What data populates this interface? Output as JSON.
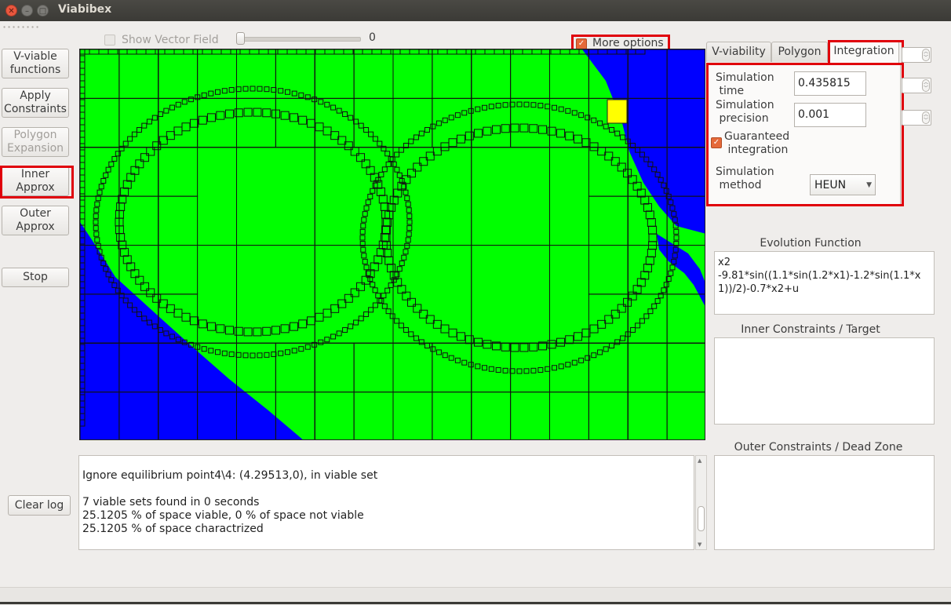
{
  "window": {
    "title": "Viabibex"
  },
  "left_buttons": {
    "vviable": "V-viable\nfunctions",
    "apply": "Apply\nConstraints",
    "polygon": "Polygon\nExpansion",
    "inner": "Inner\nApprox",
    "outer": "Outer\nApprox",
    "stop": "Stop",
    "clear_log": "Clear log"
  },
  "top_controls": {
    "show_vector_field": "Show Vector Field",
    "slider_value": "0",
    "more_options": "More options"
  },
  "tabs": [
    "V-viability",
    "Polygon",
    "Integration"
  ],
  "integration": {
    "sim_time_label": "Simulation\n time",
    "sim_time_value": "0.435815",
    "sim_precision_label": "Simulation\n precision",
    "sim_precision_value": "0.001",
    "guaranteed_label": "Guaranteed\n integration",
    "method_label": "Simulation\n method",
    "method_value": "HEUN"
  },
  "evolution": {
    "title": "Evolution Function",
    "text": "x2\n-9.81*sin((1.1*sin(1.2*x1)-1.2*sin(1.1*x1))/2)-0.7*x2+u"
  },
  "inner_constraints": {
    "title": "Inner Constraints / Target",
    "text": ""
  },
  "outer_constraints": {
    "title": "Outer Constraints / Dead Zone",
    "text": ""
  },
  "log": {
    "line1": "Ignore equilibrium point4\\4: (4.29513,0), in viable set",
    "line2": "",
    "line3": "7 viable sets found in 0 seconds",
    "line4": "25.1205 % of space viable, 0 % of space not viable",
    "line5": "25.1205 % of space charactrized"
  },
  "colors": {
    "viable": "#00ff00",
    "unviable": "#0000ff",
    "highlight": "#ffff00",
    "annotation": "#e0000b"
  }
}
